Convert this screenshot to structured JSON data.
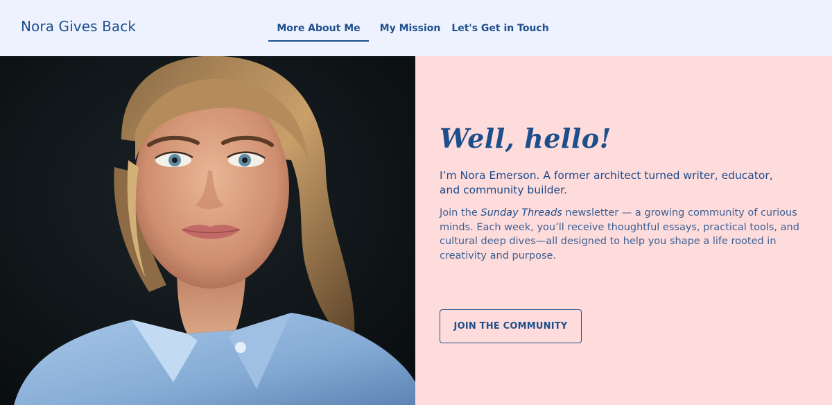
{
  "header": {
    "brand": "Nora Gives Back",
    "nav": [
      {
        "label": "More About Me"
      },
      {
        "label": "My Mission"
      },
      {
        "label": "Let's Get in Touch"
      }
    ]
  },
  "hero": {
    "greeting": "Well, hello!",
    "intro": "I’m Nora Emerson. A former architect turned writer, educator, and community builder.",
    "body_prefix": "Join the ",
    "body_emphasis": "Sunday Threads",
    "body_suffix": " newsletter — a growing community of curious minds. Each week, you’ll receive thoughtful essays, practical tools, and cultural deep dives—all designed to help you shape a life rooted in creativity and purpose.",
    "cta_label": "JOIN THE COMMUNITY"
  },
  "colors": {
    "accent": "#1d4f8c",
    "header_bg": "#eef2ff",
    "hero_bg": "#ffdcdc"
  }
}
